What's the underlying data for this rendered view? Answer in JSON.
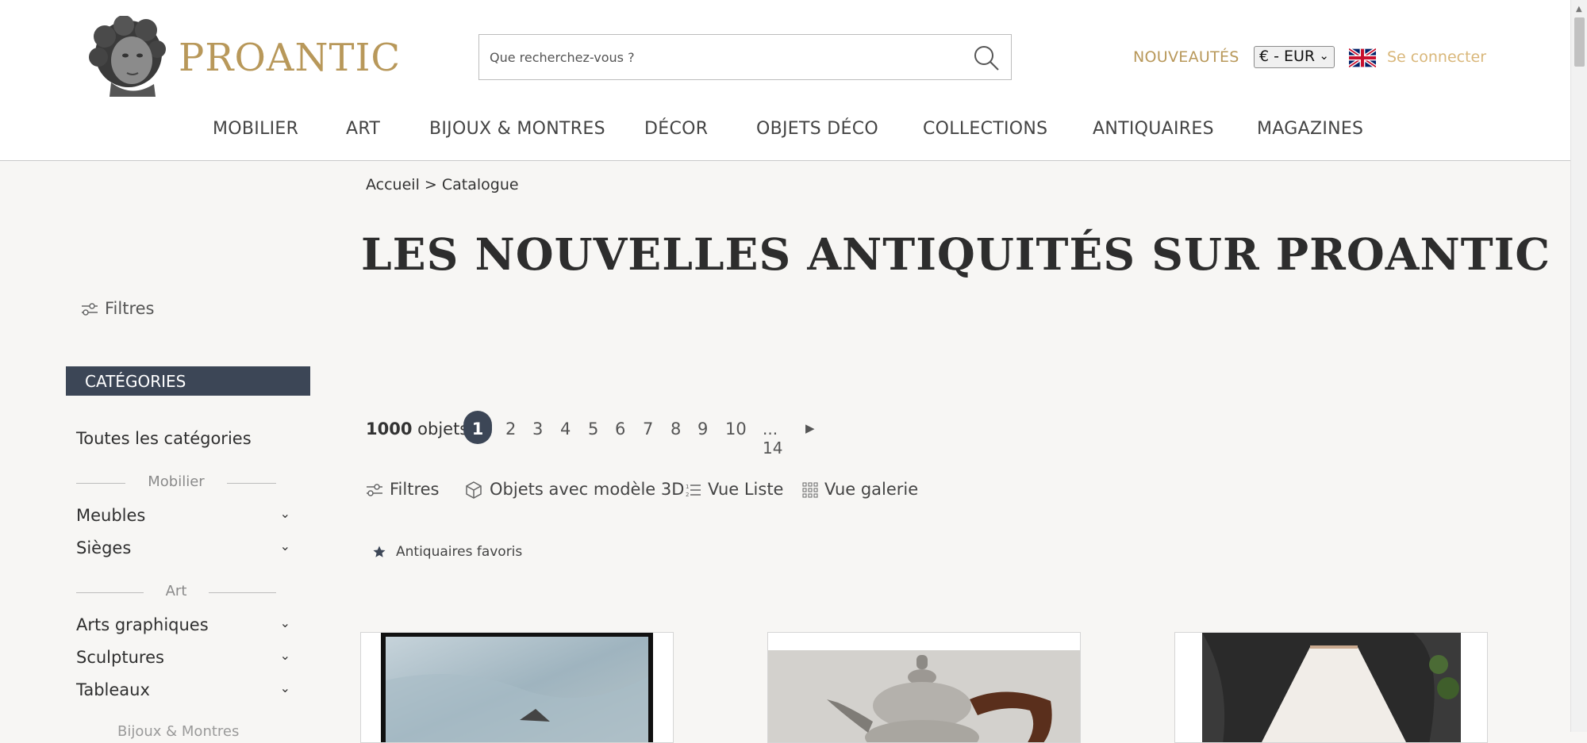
{
  "brand": {
    "name": "PROANTIC"
  },
  "search": {
    "placeholder": "Que recherchez-vous ?"
  },
  "header": {
    "new_label": "NOUVEAUTÉS",
    "currency": "€ - EUR",
    "login_label": "Se connecter",
    "language_flag": "uk-flag-icon"
  },
  "nav": {
    "items": [
      {
        "label": "MOBILIER"
      },
      {
        "label": "ART"
      },
      {
        "label": "BIJOUX & MONTRES"
      },
      {
        "label": "DÉCOR"
      },
      {
        "label": "OBJETS DÉCO"
      },
      {
        "label": "COLLECTIONS"
      },
      {
        "label": "ANTIQUAIRES"
      },
      {
        "label": "MAGAZINES"
      }
    ]
  },
  "breadcrumb": {
    "home": "Accueil",
    "separator": ">",
    "current": "Catalogue"
  },
  "page_title": "LES NOUVELLES ANTIQUITÉS SUR PROANTIC",
  "sidebar": {
    "filters_label": "Filtres",
    "categories_header": "CATÉGORIES",
    "all_categories": "Toutes les catégories",
    "section_mobilier": "Mobilier",
    "section_art": "Art",
    "section_bijoux": "Bijoux & Montres",
    "items": [
      {
        "label": "Meubles"
      },
      {
        "label": "Sièges"
      },
      {
        "label": "Arts graphiques"
      },
      {
        "label": "Sculptures"
      },
      {
        "label": "Tableaux"
      }
    ]
  },
  "results": {
    "count": "1000",
    "count_suffix": "objets",
    "pages": [
      "1",
      "2",
      "3",
      "4",
      "5",
      "6",
      "7",
      "8",
      "9",
      "10",
      "... 14"
    ],
    "current_page": "1"
  },
  "toolbar": {
    "filters": "Filtres",
    "models3d": "Objets avec modèle 3D",
    "list_view": "Vue Liste",
    "gallery_view": "Vue galerie",
    "favorites": "Antiquaires favoris"
  },
  "colors": {
    "brand_gold": "#b8985a",
    "navy": "#3c4656",
    "background": "#f7f6f4"
  }
}
